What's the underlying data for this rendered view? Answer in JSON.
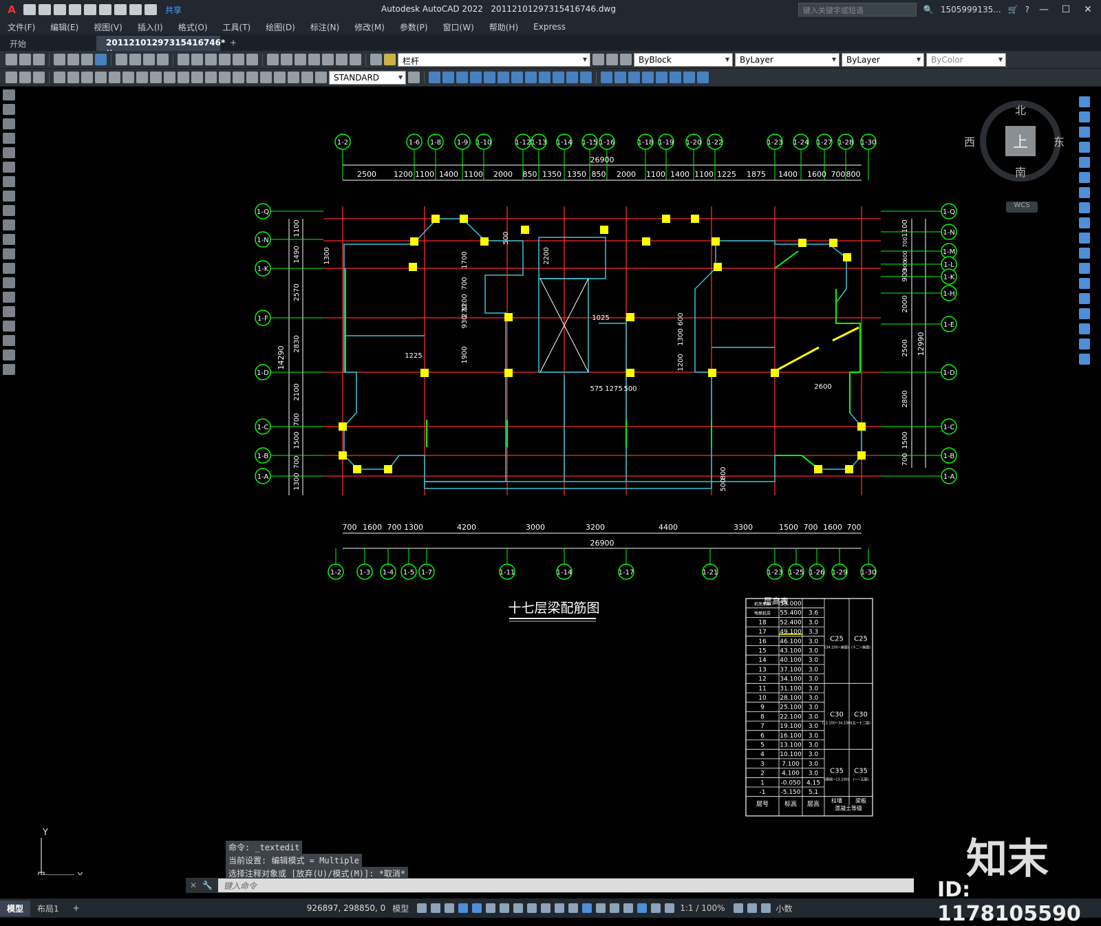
{
  "app": {
    "name": "Autodesk AutoCAD 2022",
    "file": "20112101297315416746.dwg",
    "logo_letter": "A",
    "share": "共享",
    "search_placeholder": "键入关键字或短语",
    "user": "1505999135...",
    "window_buttons": [
      "—",
      "☐",
      "✕"
    ]
  },
  "menu": [
    "文件(F)",
    "编辑(E)",
    "视图(V)",
    "插入(I)",
    "格式(O)",
    "工具(T)",
    "绘图(D)",
    "标注(N)",
    "修改(M)",
    "参数(P)",
    "窗口(W)",
    "帮助(H)",
    "Express"
  ],
  "tabs": [
    {
      "label": "开始",
      "active": false
    },
    {
      "label": "20112101297315416746*",
      "active": true
    },
    {
      "label": "+",
      "active": false
    }
  ],
  "toolbar": {
    "layer": "栏杆",
    "color": "ByBlock",
    "linetype": "ByLayer",
    "lineweight": "ByLayer",
    "plotstyle": "ByColor",
    "textstyle": "STANDARD"
  },
  "viewcube": {
    "north": "北",
    "south": "南",
    "east": "东",
    "west": "西",
    "top": "上",
    "wcs": "WCS"
  },
  "drawing": {
    "title": "十七层梁配筋图",
    "top_axes": [
      "1-2",
      "1-6",
      "1-8",
      "1-9",
      "1-10",
      "1-12",
      "1-13",
      "1-14",
      "1-15",
      "1-16",
      "1-18",
      "1-19",
      "1-20",
      "1-22",
      "1-23",
      "1-24",
      "1-27",
      "1-28",
      "1-30"
    ],
    "bottom_axes": [
      "1-2",
      "1-3",
      "1-4",
      "1-5",
      "1-7",
      "1-11",
      "1-14",
      "1-17",
      "1-21",
      "1-23",
      "1-25",
      "1-26",
      "1-29",
      "1-30"
    ],
    "left_axes": [
      "1-Q",
      "1-N",
      "1-K",
      "1-F",
      "1-D",
      "1-C",
      "1-B",
      "1-A"
    ],
    "right_axes": [
      "1-Q",
      "1-N",
      "1-M",
      "1-L",
      "1-K",
      "1-H",
      "1-E",
      "1-D",
      "1-C",
      "1-B",
      "1-A"
    ],
    "top_total": "26900",
    "bottom_total": "26900",
    "top_dims": [
      "2500",
      "1200",
      "1100",
      "1400",
      "1100",
      "2000",
      "850",
      "1350",
      "1350",
      "850",
      "2000",
      "1100",
      "1400",
      "1100",
      "1225",
      "1875",
      "1400",
      "1600",
      "700",
      "800"
    ],
    "bottom_dims": [
      "700",
      "1600",
      "700",
      "1300",
      "4200",
      "3000",
      "3200",
      "4400",
      "3300",
      "1500",
      "700",
      "1600",
      "700"
    ],
    "left_dims": [
      "1100",
      "1490",
      "2570",
      "2830",
      "2100",
      "700",
      "1500",
      "700",
      "1300"
    ],
    "left_total": "14290",
    "right_dims": [
      "1100",
      "900",
      "2000",
      "2500",
      "2800",
      "1500",
      "700"
    ],
    "right_small": [
      "700",
      "600",
      "900"
    ],
    "right_total": "12990",
    "inner_dims": [
      "1300",
      "500",
      "2200",
      "1700",
      "700",
      "1200",
      "930",
      "270",
      "1900",
      "1025",
      "600",
      "1300",
      "1200",
      "1225",
      "2600",
      "575",
      "1275",
      "500",
      "500",
      "800"
    ]
  },
  "level_table": {
    "title": "层高表",
    "rows": [
      [
        "机房屋面",
        "59.000",
        ""
      ],
      [
        "电梯机房",
        "55.400",
        "3.6"
      ],
      [
        "18",
        "52.400",
        "3.0"
      ],
      [
        "17",
        "49.100",
        "3.3"
      ],
      [
        "16",
        "46.100",
        "3.0"
      ],
      [
        "15",
        "43.100",
        "3.0"
      ],
      [
        "14",
        "40.100",
        "3.0"
      ],
      [
        "13",
        "37.100",
        "3.0"
      ],
      [
        "12",
        "34.100",
        "3.0"
      ],
      [
        "11",
        "31.100",
        "3.0"
      ],
      [
        "10",
        "28.100",
        "3.0"
      ],
      [
        "9",
        "25.100",
        "3.0"
      ],
      [
        "8",
        "22.100",
        "3.0"
      ],
      [
        "7",
        "19.100",
        "3.0"
      ],
      [
        "6",
        "16.100",
        "3.0"
      ],
      [
        "5",
        "13.100",
        "3.0"
      ],
      [
        "4",
        "10.100",
        "3.0"
      ],
      [
        "3",
        "7.100",
        "3.0"
      ],
      [
        "2",
        "4.100",
        "3.0"
      ],
      [
        "1",
        "-0.050",
        "4.15"
      ],
      [
        "-1",
        "-5.150",
        "5.1"
      ]
    ],
    "concrete": [
      {
        "beam": "C25",
        "col": "C25",
        "beam_note": "(34.100~屋面)",
        "col_note": "(十二~屋面)"
      },
      {
        "beam": "C30",
        "col": "C30",
        "beam_note": "(13.100~34.100)",
        "col_note": "(五~十二层)"
      },
      {
        "beam": "C35",
        "col": "C35",
        "beam_note": "(基础~13.100)",
        "col_note": "(一~五层)"
      }
    ],
    "footer": [
      "层号",
      "标高",
      "层高",
      "柱墙",
      "梁板"
    ],
    "footer_note": "混凝土等级"
  },
  "command": {
    "history": [
      "命令: _textedit",
      "当前设置: 编辑模式 = Multiple",
      "选择注释对象或 [放弃(U)/模式(M)]: *取消*"
    ],
    "placeholder": "键入命令"
  },
  "status": {
    "layouts": [
      {
        "label": "模型",
        "active": true
      },
      {
        "label": "布局1",
        "active": false
      },
      {
        "label": "+",
        "active": false
      }
    ],
    "coords": "926897, 298850, 0",
    "space": "模型",
    "scale": "1:1 / 100%",
    "units": "小数"
  },
  "watermark": {
    "logo": "知末",
    "id": "ID: 1178105590"
  },
  "ucs": {
    "x": "X",
    "y": "Y"
  },
  "colors": {
    "axis": "#00ff00",
    "column": "#ffff00",
    "beam_red": "#ff2a2a",
    "beam_cyan": "#37c6d9",
    "dim": "#ffffff",
    "background": "#000000"
  }
}
